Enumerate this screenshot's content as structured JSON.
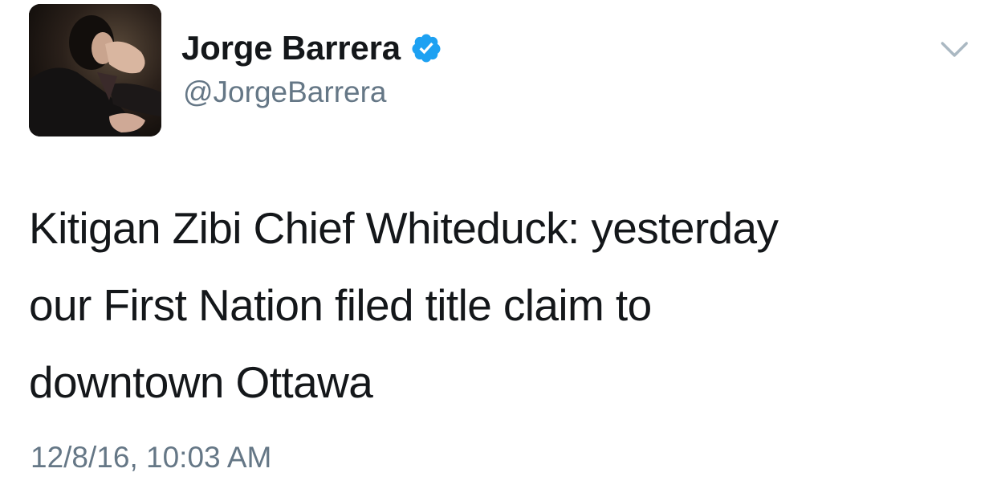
{
  "tweet": {
    "author": {
      "display_name": "Jorge Barrera",
      "handle": "@JorgeBarrera",
      "verified": true,
      "avatar_icon": "profile-photo"
    },
    "text": "Kitigan Zibi Chief Whiteduck: yesterday\nour First Nation filed title claim to\ndowntown Ottawa",
    "timestamp": "12/8/16, 10:03 AM",
    "menu_icon": "chevron-down-icon"
  },
  "colors": {
    "text_primary": "#14171a",
    "text_secondary": "#657786",
    "verified_blue": "#1da1f2",
    "chevron": "#aab8c2",
    "background": "#ffffff"
  }
}
